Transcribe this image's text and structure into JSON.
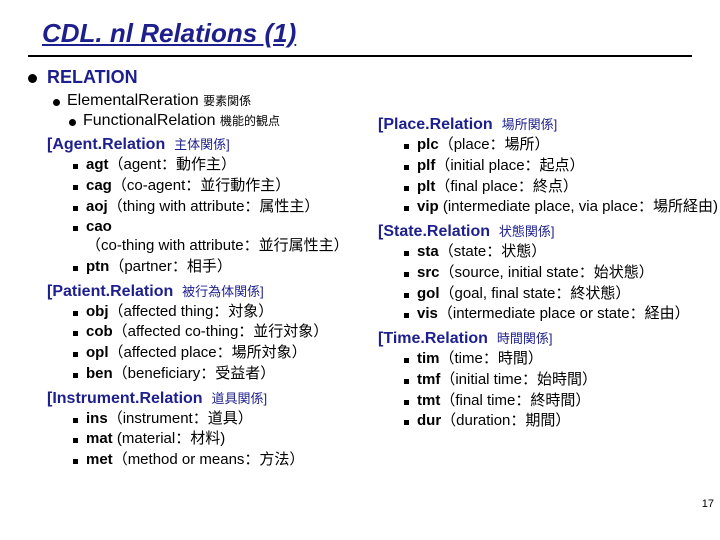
{
  "slide": {
    "title": "CDL. nl Relations (1)",
    "heading": "RELATION",
    "elemental": {
      "label": "ElementalReration",
      "jp": "要素関係"
    },
    "functional": {
      "label": "FunctionalRelation",
      "jp": "機能的観点"
    },
    "page_number": "17"
  },
  "left_groups": [
    {
      "head": "[Agent.Relation",
      "jp": "主体関係]",
      "items": [
        {
          "abbr": "agt",
          "rest": "（agent：動作主）"
        },
        {
          "abbr": "cag",
          "rest": "（co-agent：並行動作主）"
        },
        {
          "abbr": "aoj",
          "rest": "（thing with attribute：属性主）"
        },
        {
          "abbr": "cao",
          "rest": "（co-thing with attribute：並行属性主）"
        },
        {
          "abbr": "ptn",
          "rest": "（partner：相手）"
        }
      ]
    },
    {
      "head": "[Patient.Relation",
      "jp": "被行為体関係]",
      "items": [
        {
          "abbr": "obj",
          "rest": "（affected thing：対象）"
        },
        {
          "abbr": "cob",
          "rest": "（affected co-thing：並行対象）"
        },
        {
          "abbr": "opl",
          "rest": "（affected place：場所対象）"
        },
        {
          "abbr": "ben",
          "rest": "（beneficiary：受益者）"
        }
      ]
    },
    {
      "head": "[Instrument.Relation",
      "jp": "道具関係]",
      "items": [
        {
          "abbr": "ins",
          "rest": "（instrument：道具）"
        },
        {
          "abbr": "mat",
          "rest": " (material：材料)"
        },
        {
          "abbr": "met",
          "rest": "（method or means：方法）"
        }
      ]
    }
  ],
  "right_groups": [
    {
      "head": "[Place.Relation",
      "jp": "場所関係]",
      "items": [
        {
          "abbr": "plc",
          "rest": "（place：場所）"
        },
        {
          "abbr": "plf",
          "rest": "（initial place：起点）"
        },
        {
          "abbr": "plt",
          "rest": "（final place：終点）"
        },
        {
          "abbr": "vip",
          "rest": " (intermediate place, via place：場所経由)"
        }
      ]
    },
    {
      "head": "[State.Relation",
      "jp": "状態関係]",
      "items": [
        {
          "abbr": "sta",
          "rest": "（state：状態）"
        },
        {
          "abbr": "src",
          "rest": "（source, initial state：始状態）"
        },
        {
          "abbr": "gol",
          "rest": "（goal, final state：終状態）"
        },
        {
          "abbr": "vis",
          "rest": "（intermediate place or state：経由）"
        }
      ]
    },
    {
      "head": "[Time.Relation",
      "jp": "時間関係]",
      "items": [
        {
          "abbr": "tim",
          "rest": "（time：時間）"
        },
        {
          "abbr": "tmf",
          "rest": "（initial time：始時間）"
        },
        {
          "abbr": "tmt",
          "rest": "（final time：終時間）"
        },
        {
          "abbr": "dur",
          "rest": "（duration：期間）"
        }
      ]
    }
  ]
}
